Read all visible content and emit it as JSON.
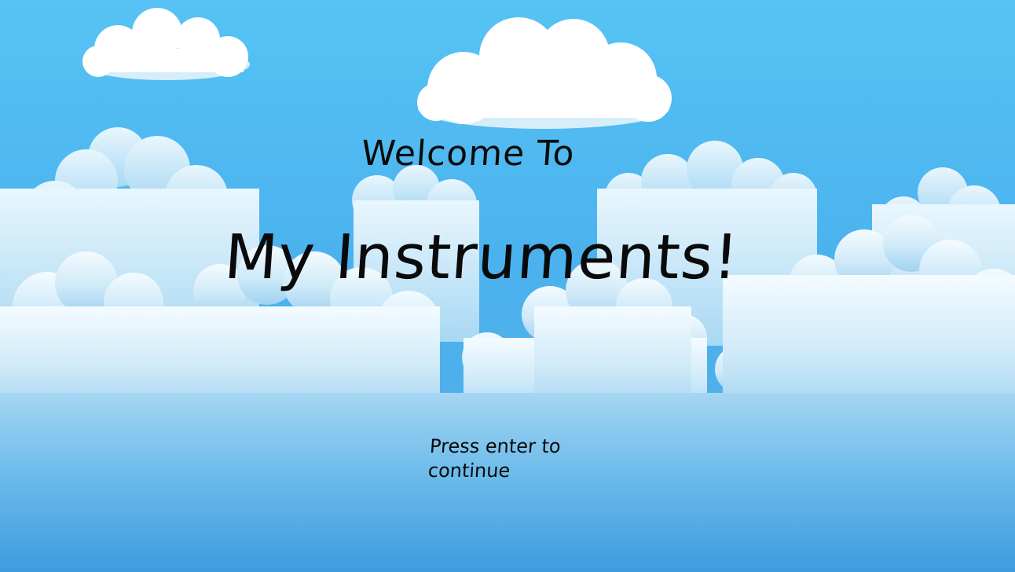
{
  "screen": {
    "name": "title-screen",
    "background_sky_color": "#4bb2ee",
    "cloud_color": "#ffffff",
    "text_color": "#0a0a0a"
  },
  "title": {
    "welcome": "Welcome To",
    "game_name": "My Instruments!"
  },
  "prompt": {
    "text": "Press enter to continue"
  }
}
